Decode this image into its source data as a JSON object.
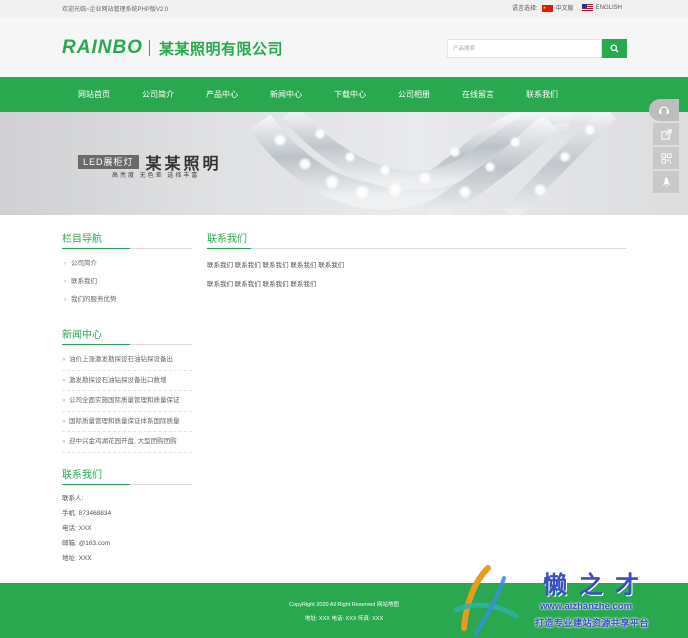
{
  "topbar": {
    "welcome": "欢迎光临~企业网站管理系统PHP版V2.0",
    "lang_label": "语言选择:",
    "lang_cn": "中文版",
    "lang_en": "ENGLISH"
  },
  "header": {
    "logo_en": "RAINBO",
    "logo_cn": "某某照明有限公司",
    "search_placeholder": "产品搜索"
  },
  "nav": {
    "items": [
      "网站首页",
      "公司简介",
      "产品中心",
      "新闻中心",
      "下载中心",
      "公司相册",
      "在线留言",
      "联系我们"
    ]
  },
  "banner": {
    "tag": "LED展柜灯",
    "title": "某某照明",
    "subtitle": "高亮度   无色差   选择丰富"
  },
  "sidebar": {
    "nav_title": "栏目导航",
    "nav_items": [
      "公司简介",
      "联系我们",
      "我们的服务优势"
    ],
    "news_title": "新闻中心",
    "news_items": [
      "油价上涨激发勘探设石油钻探设备出",
      "激发勘探设石油钻探设备出口数增",
      "公司全面实施国际质量管理和质量保证",
      "国际质量管理和质量保证体系国际质量",
      "迎中兴金鸡湖花园开盘, 大型团购团购"
    ],
    "contact_title": "联系我们",
    "contact_items": [
      "联系人:",
      "手机:  873468834",
      "电话:  XXX",
      "邮箱:  @163.com",
      "地址:  XXX"
    ]
  },
  "main": {
    "title": "联系我们",
    "line1": "联系我们 联系我们 联系我们 联系我们 联系我们",
    "line2": "联系我们 联系我们 联系我们 联系我们"
  },
  "footer": {
    "copyright": "CopyRight 2020 All Right Reserved 网站地图",
    "address": "地址:  XXX  电话:  XXX  传真:  XXX"
  },
  "watermark": {
    "brand": "懒之才",
    "url": "www.aizhanzhe.com",
    "slogan": "打造专业建站资源共享平台"
  },
  "colors": {
    "brand_green": "#2aa84f",
    "watermark_blue": "#3a4ec2"
  }
}
